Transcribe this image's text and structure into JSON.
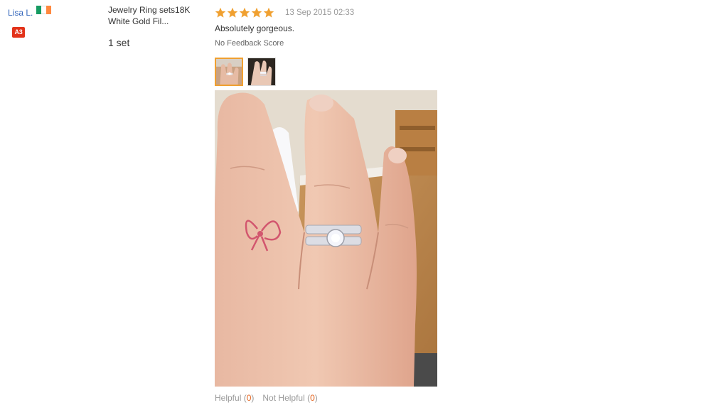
{
  "reviewer": {
    "name": "Lisa L.",
    "country_flag_colors": [
      "#169b62",
      "#ffffff",
      "#ff883e"
    ],
    "level_badge": "A3",
    "badge_color": "#e3331a"
  },
  "product": {
    "name": "Jewelry Ring sets18K White Gold Fil...",
    "quantity": "1 set"
  },
  "review": {
    "rating": 5,
    "max_rating": 5,
    "star_color": "#f0a030",
    "date": "13 Sep 2015 02:33",
    "text": "Absolutely gorgeous.",
    "feedback_score": "No Feedback Score",
    "thumbnails": [
      "photo-thumbnail-1",
      "photo-thumbnail-2"
    ],
    "selected_thumbnail": 1
  },
  "votes": {
    "helpful_label": "Helpful",
    "helpful_count": "0",
    "not_helpful_label": "Not Helpful",
    "not_helpful_count": "0"
  }
}
